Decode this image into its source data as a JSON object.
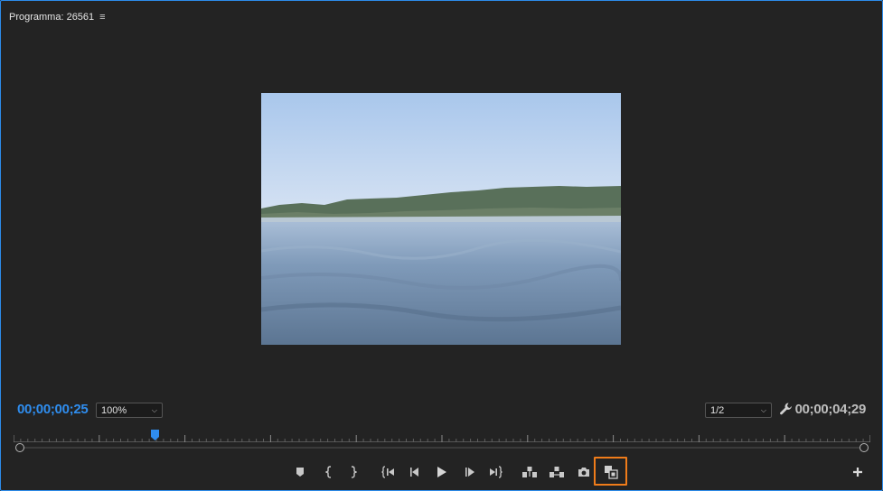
{
  "panel": {
    "title": "Programma: 26561",
    "menu_icon": "hamburger-menu-icon"
  },
  "monitor": {
    "current_timecode": "00;00;00;25",
    "duration_timecode": "00;00;04;29",
    "zoom_value": "100%",
    "resolution_value": "1/2"
  },
  "colors": {
    "accent": "#2f8dee",
    "highlight": "#f07c1a",
    "background": "#232323"
  },
  "controls": [
    {
      "name": "add-marker-button",
      "icon": "marker-icon"
    },
    {
      "name": "mark-in-button",
      "icon": "mark-in-icon"
    },
    {
      "name": "mark-out-button",
      "icon": "mark-out-icon"
    },
    {
      "name": "go-to-in-button",
      "icon": "go-to-in-icon"
    },
    {
      "name": "step-back-button",
      "icon": "step-back-icon"
    },
    {
      "name": "play-button",
      "icon": "play-icon"
    },
    {
      "name": "step-forward-button",
      "icon": "step-forward-icon"
    },
    {
      "name": "go-to-out-button",
      "icon": "go-to-out-icon"
    },
    {
      "name": "lift-button",
      "icon": "lift-icon"
    },
    {
      "name": "extract-button",
      "icon": "extract-icon"
    },
    {
      "name": "export-frame-button",
      "icon": "camera-icon"
    },
    {
      "name": "comparison-view-button",
      "icon": "comparison-view-icon"
    }
  ]
}
